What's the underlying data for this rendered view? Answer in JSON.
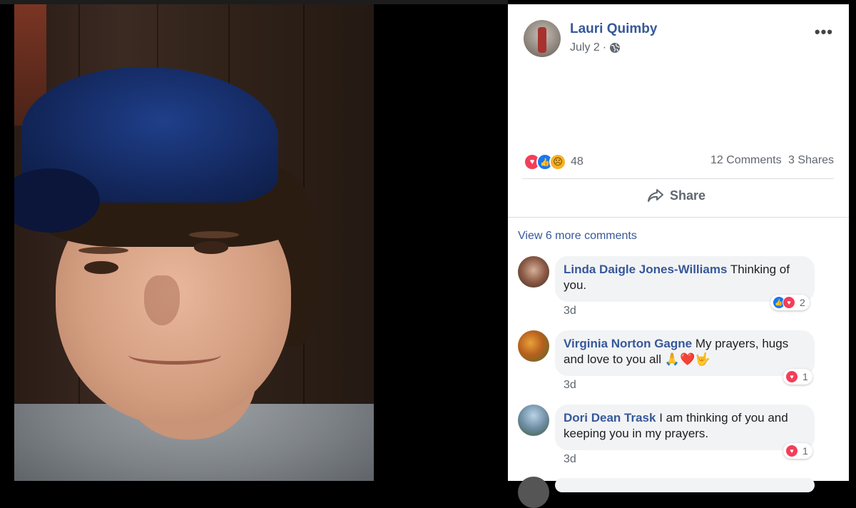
{
  "post": {
    "author": "Lauri Quimby",
    "date": "July 2",
    "date_separator": " · ",
    "more_icon": "more-options-icon",
    "privacy_icon": "globe-icon"
  },
  "stats": {
    "reaction_count": "48",
    "comments": "12 Comments",
    "shares": "3 Shares"
  },
  "actions": {
    "share_label": "Share"
  },
  "view_more": "View 6 more comments",
  "comments": [
    {
      "author": "Linda Daigle Jones-Williams",
      "text": "Thinking of you.",
      "time": "3d",
      "reaction_count": "2",
      "reactions": [
        "like",
        "love"
      ]
    },
    {
      "author": "Virginia Norton Gagne",
      "text": "My prayers, hugs and love to you all",
      "emoji": "🙏❤️🤟",
      "time": "3d",
      "reaction_count": "1",
      "reactions": [
        "love"
      ]
    },
    {
      "author": "Dori Dean Trask",
      "text": "I am thinking of you and keeping you in my prayers.",
      "time": "3d",
      "reaction_count": "1",
      "reactions": [
        "love"
      ]
    }
  ],
  "colors": {
    "link_blue": "#365899",
    "love_red": "#f33e58",
    "like_blue": "#1877f2",
    "bubble_gray": "#f2f3f5"
  }
}
